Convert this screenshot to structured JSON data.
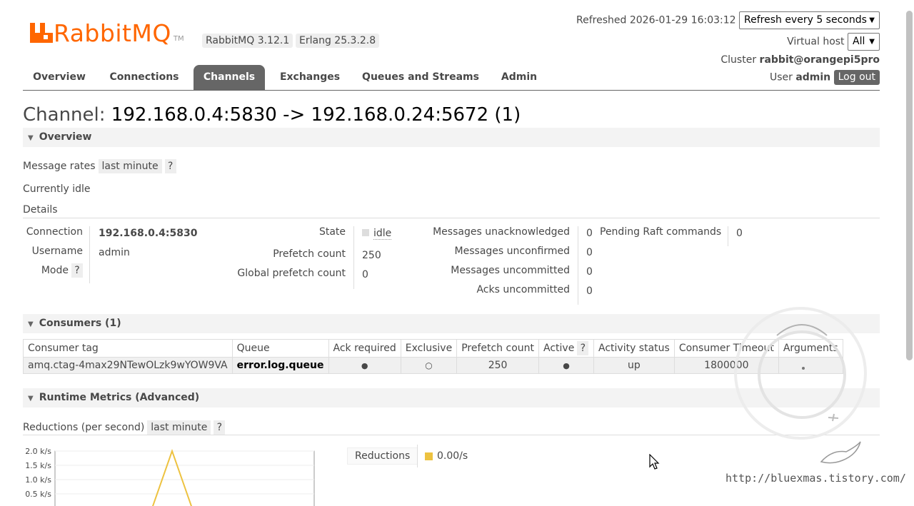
{
  "header": {
    "logo_text": "RabbitMQ",
    "logo_tm": "TM",
    "rabbitmq_version": "RabbitMQ 3.12.1",
    "erlang_version": "Erlang 25.3.2.8",
    "refreshed_label": "Refreshed 2026-01-29 16:03:12",
    "refresh_select": "Refresh every 5 seconds",
    "vhost_label": "Virtual host",
    "vhost_select": "All",
    "cluster_label": "Cluster",
    "cluster_name": "rabbit@orangepi5pro",
    "user_label": "User",
    "user_name": "admin",
    "logout_label": "Log out"
  },
  "nav": {
    "tabs": [
      "Overview",
      "Connections",
      "Channels",
      "Exchanges",
      "Queues and Streams",
      "Admin"
    ],
    "active": "Channels"
  },
  "page": {
    "title_prefix": "Channel:",
    "title_value": "192.168.0.4:5830 -> 192.168.0.24:5672 (1)"
  },
  "overview": {
    "section_title": "Overview",
    "message_rates_label": "Message rates",
    "rate_range": "last minute",
    "help": "?",
    "idle_text": "Currently idle",
    "details_label": "Details",
    "connection_label": "Connection",
    "connection_value": "192.168.0.4:5830",
    "username_label": "Username",
    "username_value": "admin",
    "mode_label": "Mode",
    "state_label": "State",
    "state_value": "idle",
    "prefetch_label": "Prefetch count",
    "prefetch_value": "250",
    "global_prefetch_label": "Global prefetch count",
    "global_prefetch_value": "0",
    "unacked_label": "Messages unacknowledged",
    "unacked_value": "0",
    "unconfirmed_label": "Messages unconfirmed",
    "unconfirmed_value": "0",
    "uncommitted_label": "Messages uncommitted",
    "uncommitted_value": "0",
    "acks_uncommitted_label": "Acks uncommitted",
    "acks_uncommitted_value": "0",
    "raft_label": "Pending Raft commands",
    "raft_value": "0"
  },
  "consumers": {
    "section_title": "Consumers (1)",
    "columns": [
      "Consumer tag",
      "Queue",
      "Ack required",
      "Exclusive",
      "Prefetch count",
      "Active",
      "Activity status",
      "Consumer Timeout",
      "Arguments"
    ],
    "active_help": "?",
    "rows": [
      {
        "tag": "amq.ctag-4max29NTewOLzk9wYOW9VA",
        "queue": "error.log.queue",
        "ack_required": "●",
        "exclusive": "○",
        "prefetch": "250",
        "active": "●",
        "status": "up",
        "timeout": "1800000",
        "arguments": ""
      }
    ]
  },
  "runtime": {
    "section_title": "Runtime Metrics (Advanced)",
    "reductions_label": "Reductions (per second)",
    "rate_range": "last minute",
    "help": "?",
    "legend_name": "Reductions",
    "legend_value": "0.00/s",
    "legend_color": "#edc240"
  },
  "chart_data": {
    "type": "line",
    "y_ticks": [
      "2.0 k/s",
      "1.5 k/s",
      "1.0 k/s",
      "0.5 k/s"
    ],
    "ylim": [
      0,
      2.0
    ],
    "x": [
      0,
      1,
      2,
      3,
      4
    ],
    "series": [
      {
        "name": "Reductions",
        "values": [
          0,
          0,
          2.0,
          0,
          0
        ],
        "color": "#edc240"
      }
    ]
  },
  "watermark": {
    "url_text": "http://bluexmas.tistory.com/"
  }
}
